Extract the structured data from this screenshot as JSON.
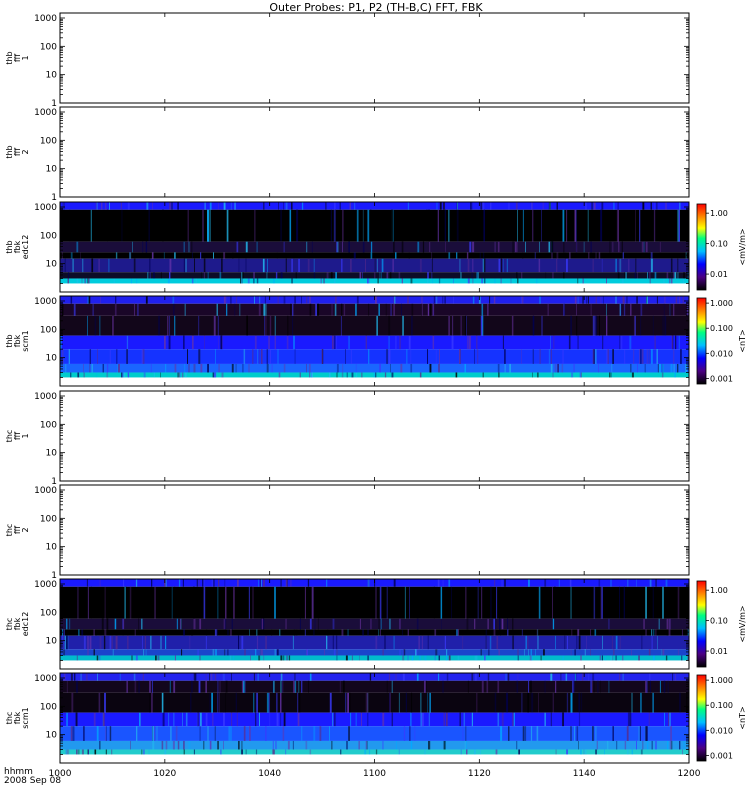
{
  "title": "Outer Probes: P1, P2 (TH-B,C) FFT, FBK",
  "time_axis": {
    "label_line1": "hhmm",
    "label_line2": "2008 Sep 08",
    "ticks": [
      "1000",
      "1020",
      "1040",
      "1100",
      "1120",
      "1140",
      "1200"
    ]
  },
  "y_ticks": [
    "1",
    "10",
    "100",
    "1000"
  ],
  "chart_data": [
    {
      "type": "line",
      "panel_label": [
        "thb",
        "fff",
        "1"
      ],
      "ylim": [
        1,
        1500
      ],
      "yscale": "log",
      "empty": true
    },
    {
      "type": "line",
      "panel_label": [
        "thb",
        "fff",
        "2"
      ],
      "ylim": [
        1,
        1500
      ],
      "yscale": "log",
      "empty": true
    },
    {
      "type": "heatmap",
      "panel_label": [
        "thb",
        "fbk",
        "edc12"
      ],
      "ylim": [
        2,
        1500
      ],
      "yscale": "log",
      "colorbar": {
        "label": "<mV/m>",
        "ticks": [
          "0.01",
          "0.10",
          "1.00"
        ],
        "range": [
          0.003,
          2.0
        ],
        "scale": "log"
      },
      "bands": [
        {
          "range": [
            800,
            1500
          ],
          "color": "#1a1aff"
        },
        {
          "range": [
            60,
            800
          ],
          "color": "#000000"
        },
        {
          "range": [
            25,
            60
          ],
          "color": "#1a0d3a"
        },
        {
          "range": [
            15,
            25
          ],
          "color": "#000000"
        },
        {
          "range": [
            5,
            15
          ],
          "color": "#1e1a8c"
        },
        {
          "range": [
            3,
            5
          ],
          "color": "#0d0d28"
        },
        {
          "range": [
            2,
            3
          ],
          "color": "#00ccdd"
        }
      ]
    },
    {
      "type": "heatmap",
      "panel_label": [
        "thb",
        "fbk",
        "scm1"
      ],
      "ylim": [
        2,
        1500
      ],
      "yscale": "log",
      "colorbar": {
        "label": "<nT>",
        "ticks": [
          "0.001",
          "0.010",
          "0.100",
          "1.000"
        ],
        "range": [
          0.0006,
          1.6
        ],
        "scale": "log"
      },
      "bands": [
        {
          "range": [
            800,
            1500
          ],
          "color": "#2020ee"
        },
        {
          "range": [
            300,
            800
          ],
          "color": "#1a0628"
        },
        {
          "range": [
            60,
            300
          ],
          "color": "#12061a"
        },
        {
          "range": [
            20,
            60
          ],
          "color": "#1a1aff"
        },
        {
          "range": [
            6,
            20
          ],
          "color": "#1533ff"
        },
        {
          "range": [
            3,
            6
          ],
          "color": "#1a66ff"
        },
        {
          "range": [
            2,
            3
          ],
          "color": "#00cccc"
        }
      ]
    },
    {
      "type": "line",
      "panel_label": [
        "thc",
        "fff",
        "1"
      ],
      "ylim": [
        1,
        1500
      ],
      "yscale": "log",
      "empty": true
    },
    {
      "type": "line",
      "panel_label": [
        "thc",
        "fff",
        "2"
      ],
      "ylim": [
        1,
        1500
      ],
      "yscale": "log",
      "empty": true
    },
    {
      "type": "heatmap",
      "panel_label": [
        "thc",
        "fbk",
        "edc12"
      ],
      "ylim": [
        2,
        1500
      ],
      "yscale": "log",
      "colorbar": {
        "label": "<mV/m>",
        "ticks": [
          "0.01",
          "0.10",
          "1.00"
        ],
        "range": [
          0.003,
          2.0
        ],
        "scale": "log"
      },
      "bands": [
        {
          "range": [
            800,
            1500
          ],
          "color": "#1a1aff"
        },
        {
          "range": [
            60,
            800
          ],
          "color": "#000000"
        },
        {
          "range": [
            25,
            60
          ],
          "color": "#1a0d3a"
        },
        {
          "range": [
            15,
            25
          ],
          "color": "#000000"
        },
        {
          "range": [
            5,
            15
          ],
          "color": "#2020aa"
        },
        {
          "range": [
            3,
            5
          ],
          "color": "#1a44cc"
        },
        {
          "range": [
            2,
            3
          ],
          "color": "#00bbcc"
        }
      ]
    },
    {
      "type": "heatmap",
      "panel_label": [
        "thc",
        "fbk",
        "scm1"
      ],
      "ylim": [
        2,
        1500
      ],
      "yscale": "log",
      "colorbar": {
        "label": "<nT>",
        "ticks": [
          "0.001",
          "0.010",
          "0.100",
          "1.000"
        ],
        "range": [
          0.0006,
          1.6
        ],
        "scale": "log"
      },
      "bands": [
        {
          "range": [
            800,
            1500
          ],
          "color": "#2222ee"
        },
        {
          "range": [
            300,
            800
          ],
          "color": "#12061c"
        },
        {
          "range": [
            60,
            300
          ],
          "color": "#0a0410"
        },
        {
          "range": [
            20,
            60
          ],
          "color": "#1a1aff"
        },
        {
          "range": [
            6,
            20
          ],
          "color": "#1a55ff"
        },
        {
          "range": [
            3,
            6
          ],
          "color": "#2299ee"
        },
        {
          "range": [
            2,
            3
          ],
          "color": "#22cccc"
        }
      ]
    }
  ]
}
